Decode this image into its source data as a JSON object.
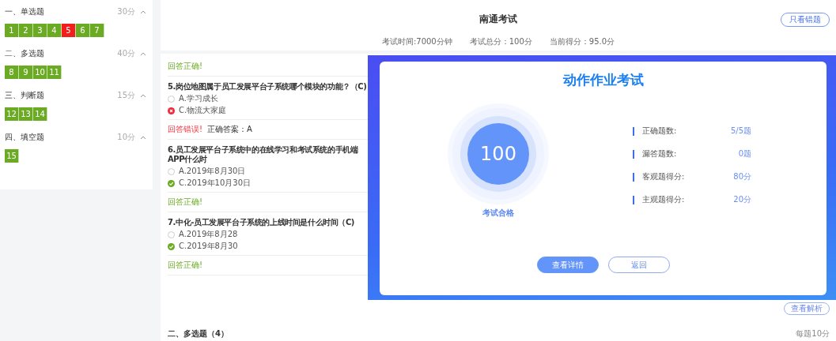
{
  "sidebar": {
    "sections": [
      {
        "title": "一、单选题",
        "score": "30分",
        "expanded": true,
        "questions": [
          {
            "number": "1",
            "correct": true
          },
          {
            "number": "2",
            "correct": true
          },
          {
            "number": "3",
            "correct": true
          },
          {
            "number": "4",
            "correct": true
          },
          {
            "number": "5",
            "correct": false
          },
          {
            "number": "6",
            "correct": true
          },
          {
            "number": "7",
            "correct": true
          }
        ]
      },
      {
        "title": "二、多选题",
        "score": "40分",
        "expanded": true,
        "questions": [
          {
            "number": "8",
            "correct": true
          },
          {
            "number": "9",
            "correct": true
          },
          {
            "number": "10",
            "correct": true
          },
          {
            "number": "11",
            "correct": true
          }
        ]
      },
      {
        "title": "三、判断题",
        "score": "15分",
        "expanded": true,
        "questions": [
          {
            "number": "12",
            "correct": true
          },
          {
            "number": "13",
            "correct": true
          },
          {
            "number": "14",
            "correct": true
          }
        ]
      },
      {
        "title": "四、填空题",
        "score": "10分",
        "expanded": true,
        "questions": [
          {
            "number": "15",
            "correct": true
          }
        ]
      }
    ]
  },
  "header": {
    "title": "南通考试",
    "filter_button": "只看错题",
    "stats": [
      "考试时间:7000分钟",
      "考试总分：100分",
      "当前得分：95.0分"
    ]
  },
  "feed": [
    {
      "kind": "feedback",
      "correct": true,
      "status": "回答正确!"
    },
    {
      "kind": "question",
      "text": "5.岗位地图属于员工发展平台子系统哪个模块的功能？（C)",
      "options": [
        {
          "label": "A.学习成长",
          "selected": false
        },
        {
          "label": "C.物流大家庭",
          "selected": true,
          "correct": false
        }
      ]
    },
    {
      "kind": "feedback",
      "correct": false,
      "status": "回答错误!",
      "answer": "正确答案：A"
    },
    {
      "kind": "question",
      "text": "6.员工发展平台子系统中的在线学习和考试系统的手机端APP什么时",
      "options": [
        {
          "label": "A.2019年8月30日",
          "selected": false
        },
        {
          "label": "C.2019年10月30日",
          "selected": true,
          "correct": true
        }
      ]
    },
    {
      "kind": "feedback",
      "correct": true,
      "status": "回答正确!"
    },
    {
      "kind": "question",
      "text": "7.中化-员工发展平台子系统的上线时间是什么时间（C)",
      "options": [
        {
          "label": "A.2019年8月28",
          "selected": false
        },
        {
          "label": "C.2019年8月30",
          "selected": true,
          "correct": true
        }
      ]
    },
    {
      "kind": "feedback",
      "correct": true,
      "status": "回答正确!"
    }
  ],
  "analysis_button": "查看解析",
  "next_section": {
    "title": "二、多选题（4）",
    "score": "每题10分"
  },
  "result_dialog": {
    "title": "动作作业考试",
    "score": "100",
    "verdict": "考试合格",
    "stats": [
      {
        "label": "正确题数:",
        "value": "5/5题"
      },
      {
        "label": "漏答题数:",
        "value": "0题"
      },
      {
        "label": "客观题得分:",
        "value": "80分"
      },
      {
        "label": "主观题得分:",
        "value": "20分"
      }
    ],
    "buttons": [
      {
        "label": "查看详情",
        "kind": "primary"
      },
      {
        "label": "返回",
        "kind": "outline"
      }
    ]
  }
}
